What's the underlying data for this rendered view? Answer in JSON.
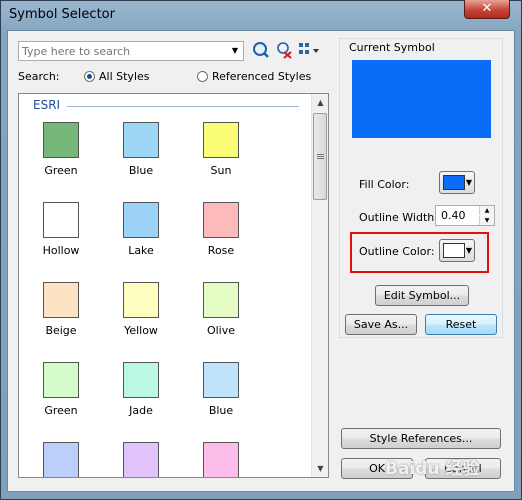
{
  "window": {
    "title": "Symbol Selector",
    "close_glyph": "✕"
  },
  "search": {
    "placeholder": "Type here to search",
    "scope_label": "Search:",
    "all_styles": "All Styles",
    "referenced_styles": "Referenced Styles",
    "selected_scope": "All Styles"
  },
  "toolbar_icons": [
    "search-icon",
    "clear-search-icon",
    "view-options-icon"
  ],
  "category": "ESRI",
  "symbols": [
    {
      "name": "Green",
      "color": "#76b676"
    },
    {
      "name": "Blue",
      "color": "#9cd8f5"
    },
    {
      "name": "Sun",
      "color": "#fbfd77"
    },
    {
      "name": "Hollow",
      "color": "#ffffff"
    },
    {
      "name": "Lake",
      "color": "#9bd2f5"
    },
    {
      "name": "Rose",
      "color": "#fcbaba"
    },
    {
      "name": "Beige",
      "color": "#fde3c1"
    },
    {
      "name": "Yellow",
      "color": "#fefec1"
    },
    {
      "name": "Olive",
      "color": "#e5fcc4"
    },
    {
      "name": "Green",
      "color": "#d3fcc8"
    },
    {
      "name": "Jade",
      "color": "#baf8e2"
    },
    {
      "name": "Blue",
      "color": "#bfe3fd"
    },
    {
      "name": "",
      "color": "#bccffb"
    },
    {
      "name": "",
      "color": "#e1c2fb"
    },
    {
      "name": "",
      "color": "#fcbdeb"
    }
  ],
  "current_symbol": {
    "title": "Current Symbol",
    "preview_color": "#0b6cf7",
    "fill_color_label": "Fill Color:",
    "fill_color": "#0b6cf7",
    "outline_width_label": "Outline Width:",
    "outline_width": "0.40",
    "outline_color_label": "Outline Color:",
    "outline_color": "#ffffff"
  },
  "buttons": {
    "edit_symbol": "Edit Symbol...",
    "save_as": "Save As...",
    "reset": "Reset",
    "style_references": "Style References...",
    "ok": "OK",
    "cancel": "Cancel"
  },
  "watermark": "Baidu 经验"
}
